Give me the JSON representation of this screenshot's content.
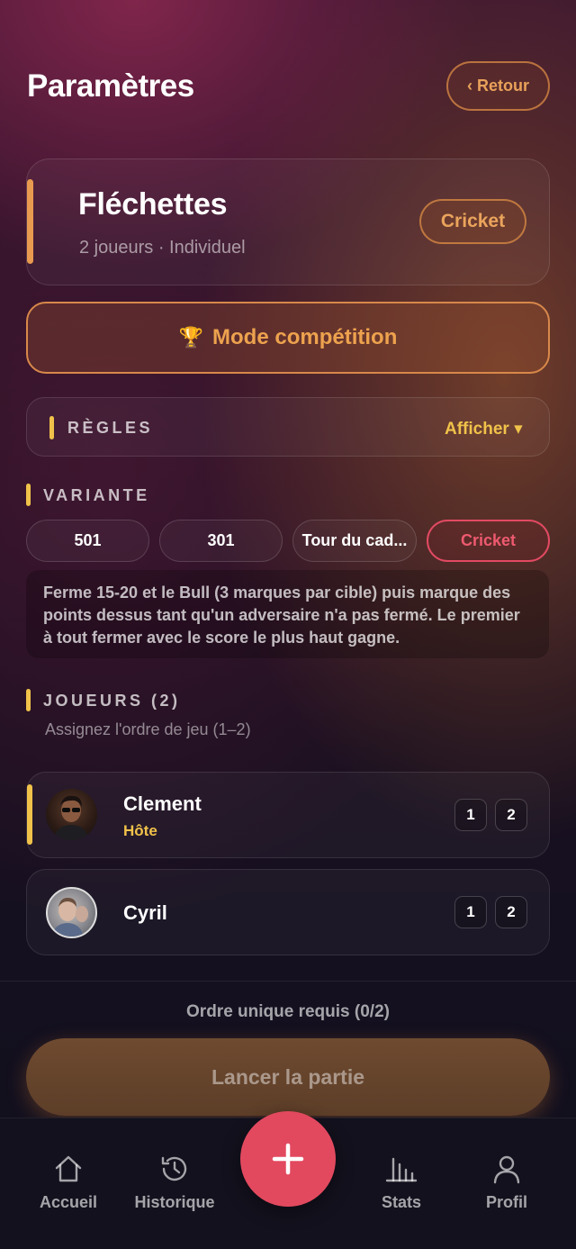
{
  "header": {
    "title": "Paramètres",
    "back_label": "‹ Retour"
  },
  "game": {
    "title": "Fléchettes",
    "subtitle": "2 joueurs · Individuel",
    "mode_pill": "Cricket"
  },
  "competition": {
    "icon": "trophy-icon",
    "label": "Mode compétition"
  },
  "rules": {
    "label": "RÈGLES",
    "toggle_label": "Afficher ▾"
  },
  "variant": {
    "label": "VARIANTE",
    "options": [
      "501",
      "301",
      "Tour du cad...",
      "Cricket"
    ],
    "selected": "Cricket",
    "description": "Ferme 15-20 et le Bull (3 marques par cible) puis marque des points dessus tant qu'un adversaire n'a pas fermé. Le premier à tout fermer avec le score le plus haut gagne."
  },
  "players": {
    "label": "JOUEURS (2)",
    "hint": "Assignez l'ordre de jeu (1–2)",
    "list": [
      {
        "name": "Clement",
        "tag": "Hôte",
        "orders": [
          "1",
          "2"
        ]
      },
      {
        "name": "Cyril",
        "tag": "",
        "orders": [
          "1",
          "2"
        ]
      }
    ]
  },
  "footer": {
    "status": "Ordre unique requis (0/2)",
    "launch_label": "Lancer la partie"
  },
  "nav": {
    "items": [
      {
        "label": "Accueil",
        "icon": "home-icon"
      },
      {
        "label": "Historique",
        "icon": "history-icon"
      },
      {
        "label": "Stats",
        "icon": "stats-icon"
      },
      {
        "label": "Profil",
        "icon": "profile-icon"
      }
    ],
    "fab_icon": "plus-icon"
  },
  "colors": {
    "accent_orange": "#e89a4f",
    "accent_yellow": "#f0c24a",
    "accent_red": "#e2495f"
  }
}
